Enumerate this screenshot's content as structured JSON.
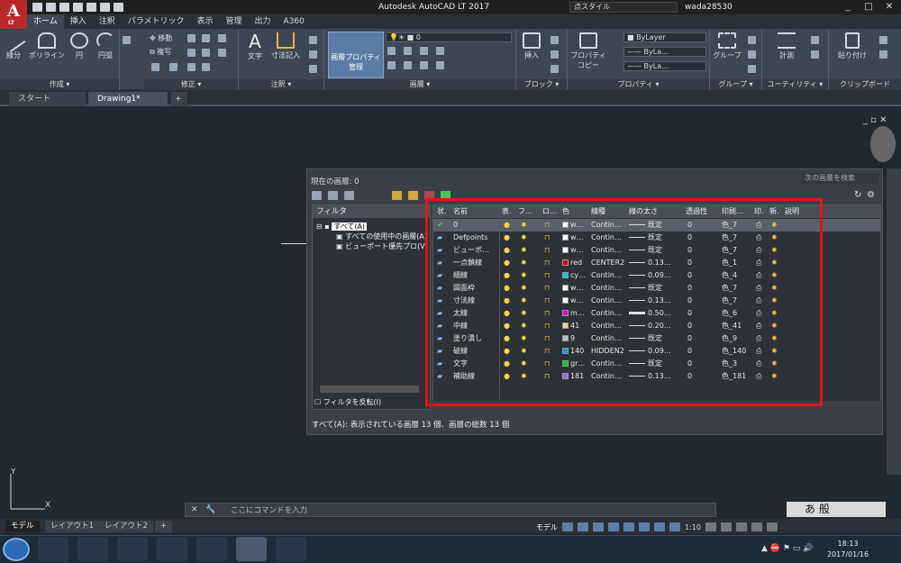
{
  "window": {
    "title": "Autodesk AutoCAD LT 2017",
    "app_letter": "A",
    "app_sub": "LT",
    "search_placeholder": "点スタイル",
    "user": "wada28530",
    "win_buttons": [
      "_",
      "□",
      "✕"
    ]
  },
  "menu_tabs": [
    "ホーム",
    "挿入",
    "注釈",
    "パラメトリック",
    "表示",
    "管理",
    "出力",
    "A360"
  ],
  "ribbon": {
    "draw": {
      "label": "作成 ▾",
      "tools": [
        "線分",
        "ポリライン",
        "円",
        "円弧"
      ]
    },
    "modify": {
      "label": "修正 ▾",
      "tools": [
        "移動",
        "複写"
      ]
    },
    "annotation": {
      "label": "注釈 ▾",
      "tools": [
        "文字",
        "寸法記入"
      ]
    },
    "layer": {
      "label": "画層 ▾",
      "button": "画層プロパティ管理",
      "current": "0"
    },
    "block": {
      "label": "ブロック ▾",
      "tools": [
        "挿入"
      ]
    },
    "props": {
      "label": "プロパティ ▾",
      "copy": "プロパティコピー",
      "color": "ByLayer",
      "ltype": "ByLa…",
      "lweight": "ByLa…"
    },
    "group": {
      "label": "グループ ▾",
      "tool": "グループ"
    },
    "utility": {
      "label": "ユーティリティ ▾",
      "tool": "計測"
    },
    "clipboard": {
      "label": "クリップボード",
      "tool": "貼り付け"
    }
  },
  "file_tabs": [
    "スタート",
    "Drawing1*",
    "+"
  ],
  "layer_manager": {
    "current_layer": "現在の画層: 0",
    "search_placeholder": "次の画層を検索",
    "filter_header": "フィルタ",
    "filter_tree": [
      "すべて(A)",
      "すべての使用中の画層(A)",
      "ビューポート優先プロ(V)"
    ],
    "invert_filter": "フィルタを反転(I)",
    "columns": [
      "状.",
      "名前",
      "表.",
      "フ…",
      "ロ…",
      "色",
      "線種",
      "線の太さ",
      "透過性",
      "印刷…",
      "印.",
      "新.",
      "説明"
    ],
    "rows": [
      {
        "name": "0",
        "color_name": "w…",
        "color": "#ffffff",
        "ltype": "Contin…",
        "lw": "既定",
        "tr": "0",
        "plot": "色_7",
        "current": true
      },
      {
        "name": "Defpoints",
        "color_name": "w…",
        "color": "#ffffff",
        "ltype": "Contin…",
        "lw": "既定",
        "tr": "0",
        "plot": "色_7"
      },
      {
        "name": "ビューポ…",
        "color_name": "w…",
        "color": "#ffffff",
        "ltype": "Contin…",
        "lw": "既定",
        "tr": "0",
        "plot": "色_7"
      },
      {
        "name": "一点鎖線",
        "color_name": "red",
        "color": "#e00000",
        "ltype": "CENTER2",
        "lw": "0.13…",
        "tr": "0",
        "plot": "色_1"
      },
      {
        "name": "細線",
        "color_name": "cy…",
        "color": "#00c8e6",
        "ltype": "Contin…",
        "lw": "0.09…",
        "tr": "0",
        "plot": "色_4"
      },
      {
        "name": "図面枠",
        "color_name": "w…",
        "color": "#ffffff",
        "ltype": "Contin…",
        "lw": "既定",
        "tr": "0",
        "plot": "色_7"
      },
      {
        "name": "寸法線",
        "color_name": "w…",
        "color": "#ffffff",
        "ltype": "Contin…",
        "lw": "0.13…",
        "tr": "0",
        "plot": "色_7"
      },
      {
        "name": "太線",
        "color_name": "m…",
        "color": "#e000e0",
        "ltype": "Contin…",
        "lw": "0.50…",
        "tr": "0",
        "plot": "色_6"
      },
      {
        "name": "中線",
        "color_name": "41",
        "color": "#ffd27f",
        "ltype": "Contin…",
        "lw": "0.20…",
        "tr": "0",
        "plot": "色_41"
      },
      {
        "name": "塗り潰し",
        "color_name": "9",
        "color": "#c0c0c0",
        "ltype": "Contin…",
        "lw": "既定",
        "tr": "0",
        "plot": "色_9"
      },
      {
        "name": "破線",
        "color_name": "140",
        "color": "#00a0e0",
        "ltype": "HIDDEN2",
        "lw": "0.09…",
        "tr": "0",
        "plot": "色_140"
      },
      {
        "name": "文字",
        "color_name": "gr…",
        "color": "#00d000",
        "ltype": "Contin…",
        "lw": "既定",
        "tr": "0",
        "plot": "色_3"
      },
      {
        "name": "補助線",
        "color_name": "181",
        "color": "#9b6fd8",
        "ltype": "Contin…",
        "lw": "0.13…",
        "tr": "0",
        "plot": "色_181"
      }
    ],
    "status": "すべて(A): 表示されている画層 13 個、画層の総数 13 個"
  },
  "command_placeholder": "ここにコマンドを入力",
  "layout_tabs": [
    "モデル",
    "レイアウト1",
    "レイアウト2",
    "+"
  ],
  "status_model": "モデル",
  "scale": "1:10",
  "ime": "あ 般",
  "clock": {
    "time": "18:13",
    "date": "2017/01/16"
  },
  "colors": {
    "accent": "#e2131a",
    "ribbon": "#3f4653",
    "canvas": "#212830"
  }
}
